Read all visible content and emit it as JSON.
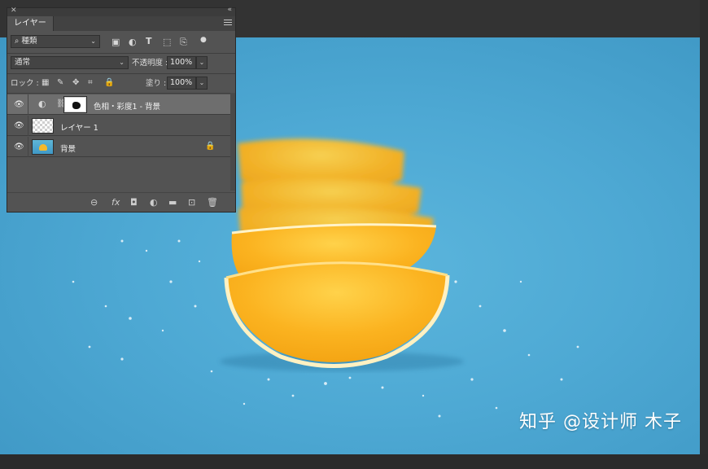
{
  "panel": {
    "close_glyph": "✕",
    "collapse_glyph": "«",
    "tab_label": "レイヤー",
    "filter": {
      "value": "種類",
      "search_icon": "⌕"
    },
    "blend_mode": "通常",
    "opacity_label": "不透明度 :",
    "opacity_value": "100%",
    "lock_label": "ロック :",
    "fill_label": "塗り :",
    "fill_value": "100%",
    "layers": [
      {
        "name": "色相・彩度1 - 背景",
        "type": "adjustment",
        "selected": true
      },
      {
        "name": "レイヤー 1",
        "type": "pixel",
        "selected": false
      },
      {
        "name": "背景",
        "type": "background",
        "locked": true,
        "selected": false
      }
    ],
    "bottom_tools": {
      "link": "⊖",
      "fx": "fx",
      "mask": "◘",
      "adjustment": "◐",
      "folder": "▬",
      "new_layer": "⊡",
      "trash": "🗑"
    }
  },
  "canvas": {
    "watermark": "知乎 @设计师 木子"
  },
  "colors": {
    "canvas_blue": "#4ea9d4",
    "lemon": "#f9b928",
    "panel_bg": "#535353"
  }
}
